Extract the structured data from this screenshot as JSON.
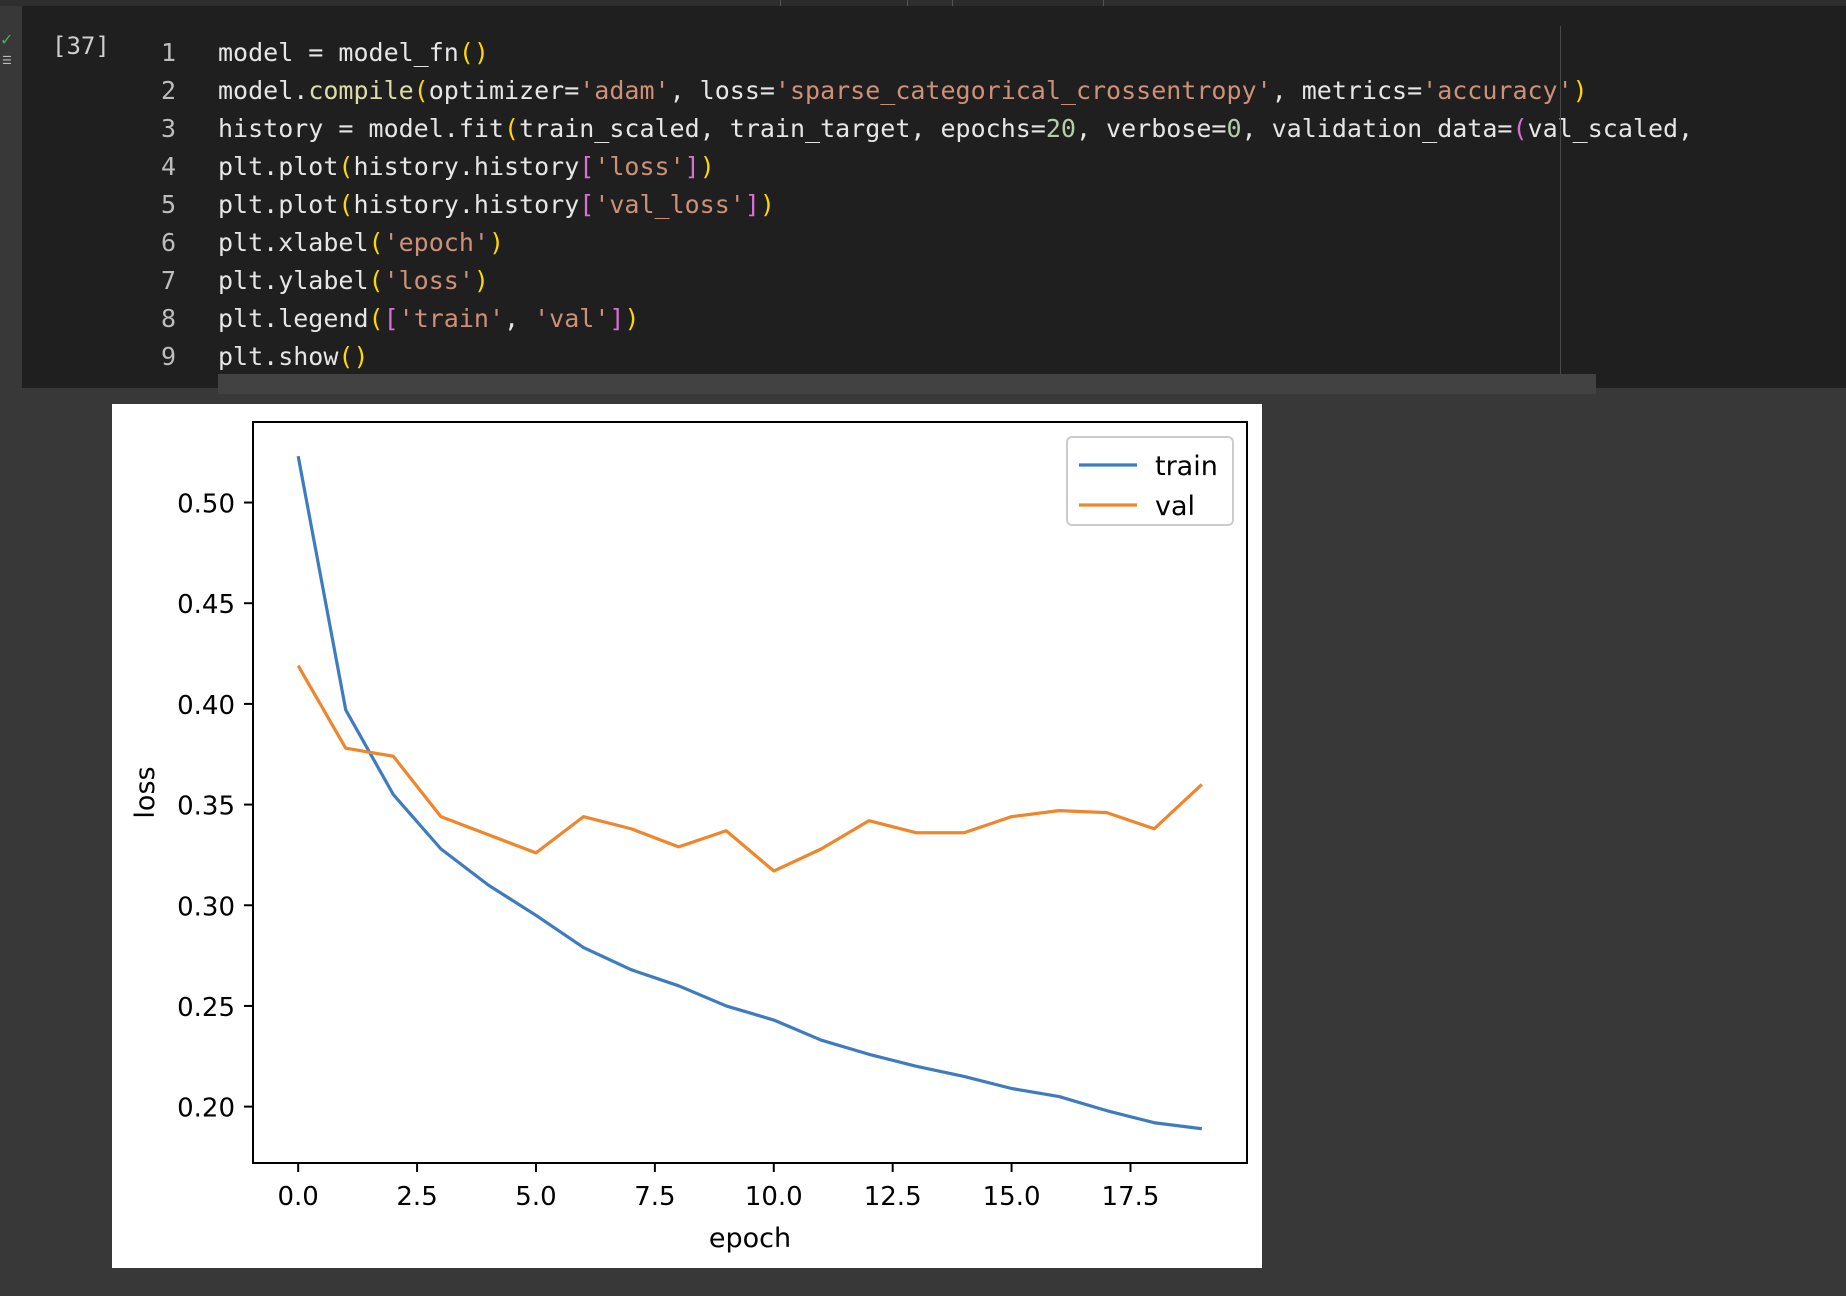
{
  "cell": {
    "execution_count": "[37]",
    "lines": [
      {
        "num": "1",
        "tokens": [
          [
            "p",
            "model = model_fn"
          ],
          [
            "br1",
            "()"
          ]
        ]
      },
      {
        "num": "2",
        "tokens": [
          [
            "p",
            "model."
          ],
          [
            "fn",
            "compile"
          ],
          [
            "br1",
            "("
          ],
          [
            "p",
            "optimizer="
          ],
          [
            "s",
            "'adam'"
          ],
          [
            "p",
            ", loss="
          ],
          [
            "s",
            "'sparse_categorical_crossentropy'"
          ],
          [
            "p",
            ", metrics="
          ],
          [
            "s",
            "'accuracy'"
          ],
          [
            "br1",
            ")"
          ]
        ]
      },
      {
        "num": "3",
        "tokens": [
          [
            "p",
            "history = model.fit"
          ],
          [
            "br1",
            "("
          ],
          [
            "p",
            "train_scaled, train_target, epochs="
          ],
          [
            "n",
            "20"
          ],
          [
            "p",
            ", verbose="
          ],
          [
            "n",
            "0"
          ],
          [
            "p",
            ", validation_data="
          ],
          [
            "br2",
            "("
          ],
          [
            "p",
            "val_scaled, "
          ]
        ]
      },
      {
        "num": "4",
        "tokens": [
          [
            "p",
            "plt.plot"
          ],
          [
            "br1",
            "("
          ],
          [
            "p",
            "history.history"
          ],
          [
            "br2",
            "["
          ],
          [
            "s",
            "'loss'"
          ],
          [
            "br2",
            "]"
          ],
          [
            "br1",
            ")"
          ]
        ]
      },
      {
        "num": "5",
        "tokens": [
          [
            "p",
            "plt.plot"
          ],
          [
            "br1",
            "("
          ],
          [
            "p",
            "history.history"
          ],
          [
            "br2",
            "["
          ],
          [
            "s",
            "'val_loss'"
          ],
          [
            "br2",
            "]"
          ],
          [
            "br1",
            ")"
          ]
        ]
      },
      {
        "num": "6",
        "tokens": [
          [
            "p",
            "plt.xlabel"
          ],
          [
            "br1",
            "("
          ],
          [
            "s",
            "'epoch'"
          ],
          [
            "br1",
            ")"
          ]
        ]
      },
      {
        "num": "7",
        "tokens": [
          [
            "p",
            "plt.ylabel"
          ],
          [
            "br1",
            "("
          ],
          [
            "s",
            "'loss'"
          ],
          [
            "br1",
            ")"
          ]
        ]
      },
      {
        "num": "8",
        "tokens": [
          [
            "p",
            "plt.legend"
          ],
          [
            "br1",
            "("
          ],
          [
            "br2",
            "["
          ],
          [
            "s",
            "'train'"
          ],
          [
            "p",
            ", "
          ],
          [
            "s",
            "'val'"
          ],
          [
            "br2",
            "]"
          ],
          [
            "br1",
            ")"
          ]
        ]
      },
      {
        "num": "9",
        "tokens": [
          [
            "p",
            "plt.show"
          ],
          [
            "br1",
            "()"
          ]
        ]
      }
    ]
  },
  "chart_data": {
    "type": "line",
    "x": [
      0,
      1,
      2,
      3,
      4,
      5,
      6,
      7,
      8,
      9,
      10,
      11,
      12,
      13,
      14,
      15,
      16,
      17,
      18,
      19
    ],
    "series": [
      {
        "name": "train",
        "color": "#3e7bbf",
        "values": [
          0.523,
          0.397,
          0.355,
          0.328,
          0.31,
          0.295,
          0.279,
          0.268,
          0.26,
          0.25,
          0.243,
          0.233,
          0.226,
          0.22,
          0.215,
          0.209,
          0.205,
          0.198,
          0.192,
          0.189
        ]
      },
      {
        "name": "val",
        "color": "#f0862b",
        "values": [
          0.419,
          0.378,
          0.374,
          0.344,
          0.335,
          0.326,
          0.344,
          0.338,
          0.329,
          0.337,
          0.317,
          0.328,
          0.342,
          0.336,
          0.336,
          0.344,
          0.347,
          0.346,
          0.338,
          0.36
        ]
      }
    ],
    "xlabel": "epoch",
    "ylabel": "loss",
    "xlim": [
      -0.95,
      19.95
    ],
    "ylim": [
      0.172,
      0.54
    ],
    "xticks": [
      "0.0",
      "2.5",
      "5.0",
      "7.5",
      "10.0",
      "12.5",
      "15.0",
      "17.5"
    ],
    "xtick_values": [
      0,
      2.5,
      5,
      7.5,
      10,
      12.5,
      15,
      17.5
    ],
    "yticks": [
      "0.20",
      "0.25",
      "0.30",
      "0.35",
      "0.40",
      "0.45",
      "0.50"
    ],
    "ytick_values": [
      0.2,
      0.25,
      0.3,
      0.35,
      0.4,
      0.45,
      0.5
    ],
    "legend_position": "upper-right",
    "grid": false
  }
}
